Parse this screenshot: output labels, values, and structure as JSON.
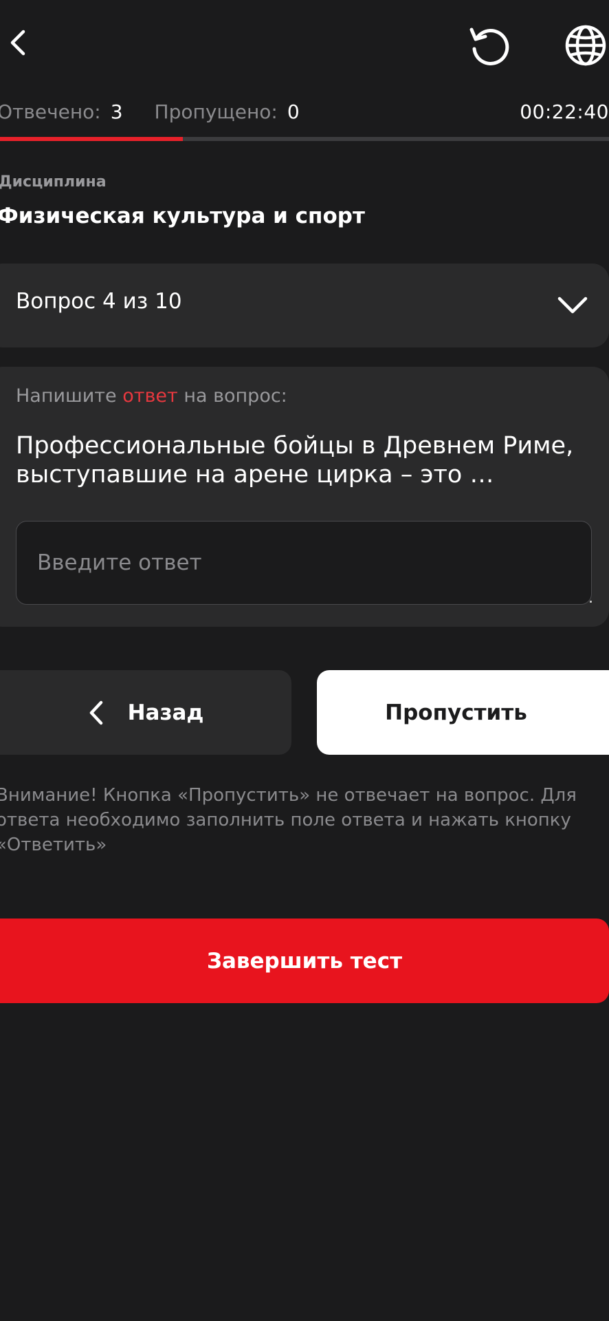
{
  "header": {
    "back_icon": "chevron-left-icon",
    "refresh_icon": "refresh-icon",
    "language_icon": "globe-icon"
  },
  "stats": {
    "answered_label": "Отвечено:",
    "answered_value": "3",
    "skipped_label": "Пропущено:",
    "skipped_value": "0",
    "timer": "00:22:40"
  },
  "progress": {
    "fraction": 0.3,
    "fill_color": "#e8212a",
    "track_color": "#3c3c3e"
  },
  "discipline": {
    "label": "Дисциплина",
    "title": "Физическая культура и спорт"
  },
  "question_selector": {
    "label": "Вопрос 4 из 10",
    "icon": "chevron-down-icon"
  },
  "question": {
    "instruction_before": "Напишите ",
    "instruction_accent": "ответ",
    "instruction_after": " на вопрос:",
    "text": "Профессиональные бойцы в Древнем Риме, выступавшие на арене цирка – это …",
    "answer_value": "",
    "answer_placeholder": "Введите ответ"
  },
  "buttons": {
    "back_label": "Назад",
    "skip_label": "Пропустить",
    "finish_label": "Завершить тест"
  },
  "warning": "Внимание! Кнопка «Пропустить» не отвечает на вопрос. Для ответа необходимо заполнить поле ответа и нажать кнопку «Ответить»",
  "colors": {
    "background": "#1b1b1c",
    "card": "#2a2a2b",
    "accent_red": "#e8141e",
    "accent_text": "#e8383f",
    "muted_text": "#8b8b8e"
  }
}
